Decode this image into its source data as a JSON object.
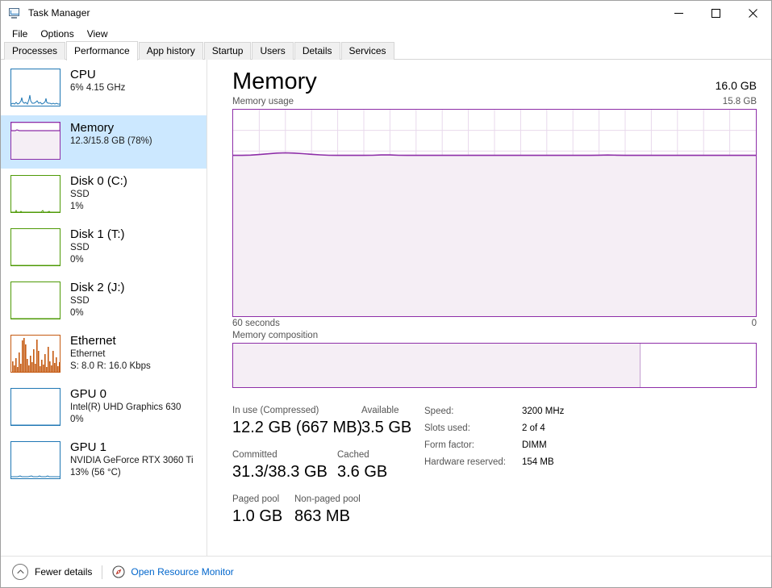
{
  "window": {
    "title": "Task Manager",
    "icon": "task-manager-icon",
    "controls": [
      {
        "name": "minimize-button",
        "glyph": "minimize-icon"
      },
      {
        "name": "maximize-button",
        "glyph": "maximize-icon"
      },
      {
        "name": "close-button",
        "glyph": "close-icon"
      }
    ]
  },
  "menu": {
    "items": [
      "File",
      "Options",
      "View"
    ]
  },
  "tabs": {
    "active": "Performance",
    "items": [
      "Processes",
      "Performance",
      "App history",
      "Startup",
      "Users",
      "Details",
      "Services"
    ]
  },
  "sidebar": {
    "items": [
      {
        "name": "sidebar-item-cpu",
        "title": "CPU",
        "line2": "6%  4.15 GHz",
        "line3": "",
        "color": "#1f77b4",
        "selected": false,
        "thumb": "line-graph-cpu"
      },
      {
        "name": "sidebar-item-memory",
        "title": "Memory",
        "line2": "12.3/15.8 GB (78%)",
        "line3": "",
        "color": "#8e2ea8",
        "selected": true,
        "thumb": "line-graph-memory"
      },
      {
        "name": "sidebar-item-disk-0",
        "title": "Disk 0 (C:)",
        "line2": "SSD",
        "line3": "1%",
        "color": "#4e9a06",
        "selected": false,
        "thumb": "line-graph-disk0"
      },
      {
        "name": "sidebar-item-disk-1",
        "title": "Disk 1 (T:)",
        "line2": "SSD",
        "line3": "0%",
        "color": "#4e9a06",
        "selected": false,
        "thumb": "line-graph-disk1"
      },
      {
        "name": "sidebar-item-disk-2",
        "title": "Disk 2 (J:)",
        "line2": "SSD",
        "line3": "0%",
        "color": "#4e9a06",
        "selected": false,
        "thumb": "line-graph-disk2"
      },
      {
        "name": "sidebar-item-ethernet",
        "title": "Ethernet",
        "line2": "Ethernet",
        "line3": "S: 8.0 R: 16.0 Kbps",
        "color": "#c55a11",
        "selected": false,
        "thumb": "area-graph-ethernet"
      },
      {
        "name": "sidebar-item-gpu-0",
        "title": "GPU 0",
        "line2": "Intel(R) UHD Graphics 630",
        "line3": "0%",
        "color": "#1f77b4",
        "selected": false,
        "thumb": "line-graph-gpu0"
      },
      {
        "name": "sidebar-item-gpu-1",
        "title": "GPU 1",
        "line2": "NVIDIA GeForce RTX 3060 Ti",
        "line3": "13%  (56 °C)",
        "color": "#1f77b4",
        "selected": false,
        "thumb": "line-graph-gpu1"
      }
    ]
  },
  "main": {
    "title": "Memory",
    "total_memory": "16.0 GB",
    "usage_label": "Memory usage",
    "usage_max_label": "15.8 GB",
    "axis_left": "60 seconds",
    "axis_right": "0",
    "composition_label": "Memory composition",
    "accent_color": "#8e2ea8",
    "fill_color": "#f5eef5"
  },
  "chart_data": {
    "type": "area",
    "title": "Memory usage",
    "xlabel": "60 seconds",
    "ylabel": "",
    "ylim": [
      0,
      15.8
    ],
    "ymax_label": "15.8 GB",
    "x_axis_left_label": "60 seconds",
    "x_axis_right_label": "0",
    "grid": true,
    "grid_columns": 20,
    "grid_rows": 10,
    "line_color": "#8e2ea8",
    "fill_color": "#f5eef5",
    "unit": "GB",
    "series": [
      {
        "name": "In use memory",
        "values": [
          12.3,
          12.3,
          12.32,
          12.36,
          12.42,
          12.47,
          12.49,
          12.47,
          12.43,
          12.38,
          12.34,
          12.31,
          12.3,
          12.3,
          12.3,
          12.3,
          12.31,
          12.33,
          12.33,
          12.31,
          12.3,
          12.3,
          12.3,
          12.3,
          12.3,
          12.3,
          12.3,
          12.3,
          12.3,
          12.3,
          12.3,
          12.3,
          12.3,
          12.3,
          12.3,
          12.3,
          12.3,
          12.3,
          12.3,
          12.3,
          12.3,
          12.3,
          12.31,
          12.32,
          12.31,
          12.3,
          12.3,
          12.3,
          12.3,
          12.3,
          12.3,
          12.3,
          12.3,
          12.3,
          12.3,
          12.3,
          12.3,
          12.3,
          12.3,
          12.3,
          12.3
        ]
      }
    ]
  },
  "composition": {
    "in_use_percent": 78,
    "segments": [
      {
        "name": "in-use",
        "percent": 78
      },
      {
        "name": "available",
        "percent": 22
      }
    ]
  },
  "stats": {
    "left": [
      {
        "pairs": [
          {
            "label": "In use (Compressed)",
            "value": "12.2 GB (667 MB)",
            "name": "stat-in-use"
          },
          {
            "label": "Available",
            "value": "3.5 GB",
            "name": "stat-available"
          }
        ]
      },
      {
        "pairs": [
          {
            "label": "Committed",
            "value": "31.3/38.3 GB",
            "name": "stat-committed"
          },
          {
            "label": "Cached",
            "value": "3.6 GB",
            "name": "stat-cached"
          }
        ]
      },
      {
        "pairs": [
          {
            "label": "Paged pool",
            "value": "1.0 GB",
            "name": "stat-paged-pool"
          },
          {
            "label": "Non-paged pool",
            "value": "863 MB",
            "name": "stat-non-paged-pool"
          }
        ]
      }
    ],
    "right": [
      {
        "label": "Speed:",
        "value": "3200 MHz",
        "name": "stat-speed"
      },
      {
        "label": "Slots used:",
        "value": "2 of 4",
        "name": "stat-slots-used"
      },
      {
        "label": "Form factor:",
        "value": "DIMM",
        "name": "stat-form-factor"
      },
      {
        "label": "Hardware reserved:",
        "value": "154 MB",
        "name": "stat-hardware-reserved"
      }
    ]
  },
  "statusbar": {
    "fewer_details": "Fewer details",
    "open_resource_monitor": "Open Resource Monitor",
    "link_color": "#0066cc"
  }
}
